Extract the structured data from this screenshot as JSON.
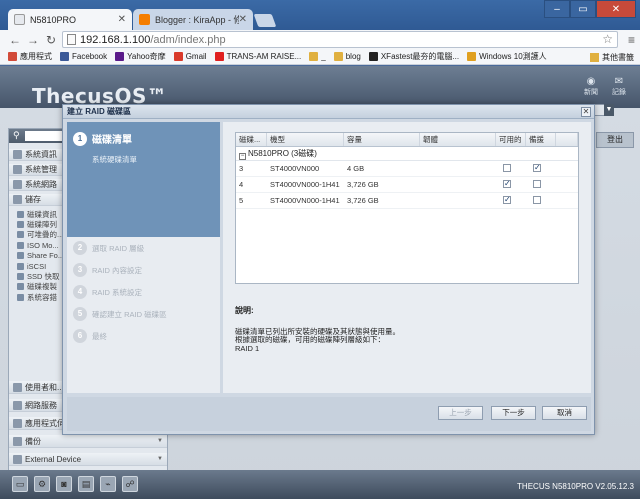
{
  "browser": {
    "tabs": [
      {
        "title": "N5810PRO",
        "active": true
      },
      {
        "title": "Blogger : KiraApp - 修改",
        "active": false
      }
    ],
    "url_host": "192.168.1.100",
    "url_path": "/adm/index.php",
    "bookmarks": [
      {
        "label": "應用程式",
        "color": "#d24b3a"
      },
      {
        "label": "Facebook",
        "color": "#3b5998"
      },
      {
        "label": "Yahoo奇摩",
        "color": "#5a1a8a"
      },
      {
        "label": "Gmail",
        "color": "#d93a2b"
      },
      {
        "label": "TRANS-AM RAISE...",
        "color": "#e02020"
      },
      {
        "label": "_",
        "color": "#e0b040"
      },
      {
        "label": "blog",
        "color": "#e0b040"
      },
      {
        "label": "XFastest最夯的電腦...",
        "color": "#222222"
      },
      {
        "label": "Windows 10測護人",
        "color": "#e0a020"
      }
    ],
    "other_bookmarks": "其他書籤"
  },
  "nas": {
    "brand": "ThecusOS™",
    "top_links": [
      {
        "label": "新聞",
        "icon": "rss-icon"
      },
      {
        "label": "記錄",
        "icon": "chat-icon"
      }
    ],
    "logout": "登出",
    "sidebar_items": [
      "系統資訊",
      "系統管理",
      "系統網路",
      "儲存"
    ],
    "sidebar_subitems": [
      "磁碟資訊",
      "磁碟陣列",
      "可堆疊的...",
      "ISO Mo...",
      "Share Fo...",
      "iSCSI",
      "SSD 快取",
      "磁碟複製",
      "系統容錯"
    ],
    "sidebar_bottom": [
      "使用者和...",
      "網路服務",
      "應用程式伺服器",
      "備份",
      "External Device"
    ],
    "version": "THECUS N5810PRO V2.05.12.3"
  },
  "dialog": {
    "title": "建立 RAID 磁碟區",
    "active_step": {
      "num": "1",
      "label": "磁碟清單",
      "desc": "系統硬碟清單"
    },
    "steps": [
      {
        "num": "2",
        "label": "選取 RAID 層級"
      },
      {
        "num": "3",
        "label": "RAID 內容設定"
      },
      {
        "num": "4",
        "label": "RAID 系統設定"
      },
      {
        "num": "5",
        "label": "確認建立 RAID 磁碟區"
      },
      {
        "num": "6",
        "label": "最終"
      }
    ],
    "columns": [
      "磁碟...",
      "機型",
      "容量",
      "韌體",
      "可用的",
      "備援"
    ],
    "group_label": "N5810PRO (3磁碟)",
    "rows": [
      {
        "disk": "3",
        "model": "ST4000VN000",
        "capacity": "4 GB",
        "firmware": "",
        "available": false,
        "spare": true
      },
      {
        "disk": "4",
        "model": "ST4000VN000-1H41",
        "capacity": "3,726 GB",
        "firmware": "",
        "available": true,
        "spare": false
      },
      {
        "disk": "5",
        "model": "ST4000VN000-1H41",
        "capacity": "3,726 GB",
        "firmware": "",
        "available": true,
        "spare": false
      }
    ],
    "help_title": "說明:",
    "help_lines": [
      "磁碟清單已列出所安裝的硬碟及其狀態與使用量。",
      "根據選取的磁碟，可用的磁碟陣列層級如下：",
      "RAID 1"
    ],
    "buttons": {
      "prev": "上一步",
      "next": "下一步",
      "cancel": "取消"
    }
  }
}
